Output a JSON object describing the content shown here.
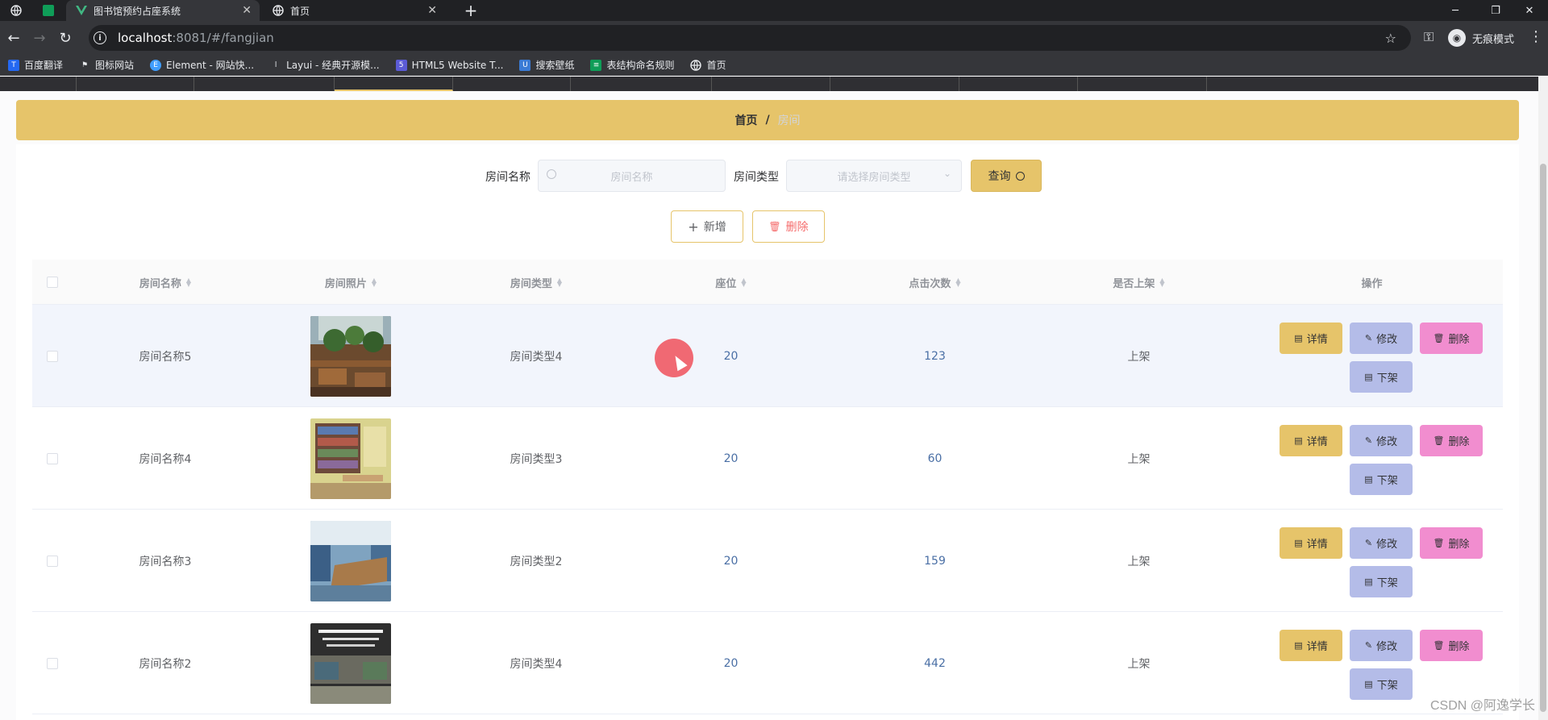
{
  "browser": {
    "tabs": [
      {
        "title": "图书馆预约占座系统",
        "active": true
      },
      {
        "title": "首页",
        "active": false
      }
    ],
    "url_host": "localhost",
    "url_rest": ":8081/#/fangjian",
    "incognito_label": "无痕模式",
    "bookmarks": [
      {
        "label": "百度翻译",
        "icon": "baidu-translate-icon",
        "color": "#2468f2"
      },
      {
        "label": "图标网站",
        "icon": "flag-icon",
        "color": "#444444"
      },
      {
        "label": "Element - 网站快...",
        "icon": "element-icon",
        "color": "#409eff"
      },
      {
        "label": "Layui - 经典开源模...",
        "icon": "layui-icon",
        "color": "#777777"
      },
      {
        "label": "HTML5 Website T...",
        "icon": "html5-icon",
        "color": "#5b5bd6"
      },
      {
        "label": "搜索壁纸",
        "icon": "wallpaper-icon",
        "color": "#3a7bd5"
      },
      {
        "label": "表结构命名规则",
        "icon": "sheet-icon",
        "color": "#0f9d58"
      },
      {
        "label": "首页",
        "icon": "globe-icon",
        "color": "#e8eaed"
      }
    ]
  },
  "breadcrumb": {
    "home": "首页",
    "separator": "/",
    "current": "房间"
  },
  "search": {
    "name_label": "房间名称",
    "name_placeholder": "房间名称",
    "type_label": "房间类型",
    "type_placeholder": "请选择房间类型",
    "query_label": "查询"
  },
  "actions": {
    "add_label": "新增",
    "delete_label": "删除"
  },
  "table": {
    "columns": [
      "房间名称",
      "房间照片",
      "房间类型",
      "座位",
      "点击次数",
      "是否上架",
      "操作"
    ],
    "row_buttons": {
      "detail": "详情",
      "edit": "修改",
      "remove": "删除",
      "off": "下架"
    },
    "rows": [
      {
        "name": "房间名称5",
        "type": "房间类型4",
        "seats": "20",
        "clicks": "123",
        "status": "上架"
      },
      {
        "name": "房间名称4",
        "type": "房间类型3",
        "seats": "20",
        "clicks": "60",
        "status": "上架"
      },
      {
        "name": "房间名称3",
        "type": "房间类型2",
        "seats": "20",
        "clicks": "159",
        "status": "上架"
      },
      {
        "name": "房间名称2",
        "type": "房间类型4",
        "seats": "20",
        "clicks": "442",
        "status": "上架"
      }
    ]
  },
  "watermark": "CSDN @阿逸学长",
  "colors": {
    "accent": "#e6c46a",
    "edit": "#b4bce8",
    "remove": "#f18dcf"
  }
}
